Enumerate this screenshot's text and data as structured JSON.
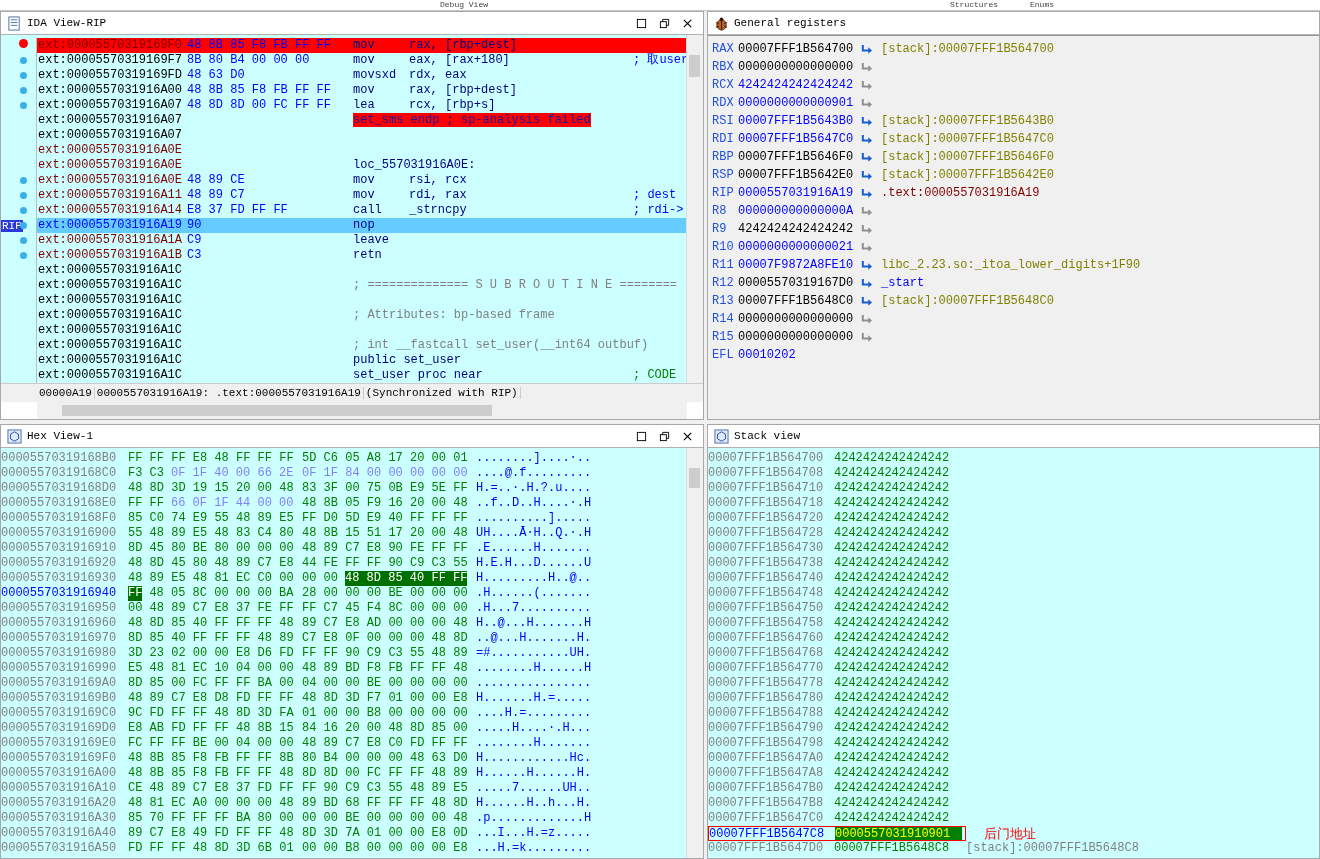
{
  "tabs": [
    {
      "label": "Debug View"
    },
    {
      "label": "Structures"
    },
    {
      "label": "Enums"
    }
  ],
  "ida_view": {
    "title": "IDA View-RIP",
    "rip_label": "RIP",
    "rows": [
      {
        "addr": "ext:00005570319169F0",
        "visited": true,
        "kind": "insn",
        "bytes": "48 8B 85 F8 FB FF FF",
        "mnem": "mov",
        "ops": "rax, [rbp+dest]",
        "breakpoint": true,
        "current": false,
        "traced": false
      },
      {
        "addr": "ext:00005570319169F7",
        "visited": false,
        "kind": "insn",
        "bytes": "8B 80 B4 00 00 00",
        "mnem": "mov",
        "ops": "eax, [rax+180]",
        "comment": "; 取user",
        "breakpoint": false,
        "current": false,
        "traced": true
      },
      {
        "addr": "ext:00005570319169FD",
        "visited": false,
        "kind": "insn",
        "bytes": "48 63 D0",
        "mnem": "movsxd",
        "ops": "rdx, eax",
        "breakpoint": false,
        "current": false,
        "traced": true
      },
      {
        "addr": "ext:0000557031916A00",
        "visited": false,
        "kind": "insn",
        "bytes": "48 8B 85 F8 FB FF FF",
        "mnem": "mov",
        "ops": "rax, [rbp+dest]",
        "breakpoint": false,
        "current": false,
        "traced": true
      },
      {
        "addr": "ext:0000557031916A07",
        "visited": false,
        "kind": "insn",
        "bytes": "48 8D 8D 00 FC FF FF",
        "mnem": "lea",
        "ops": "rcx, [rbp+s]",
        "breakpoint": false,
        "current": false,
        "traced": true
      },
      {
        "addr": "ext:0000557031916A07",
        "visited": false,
        "kind": "error",
        "text": "set_sms endp ; sp-analysis failed",
        "breakpoint": false,
        "current": false,
        "traced": false
      },
      {
        "addr": "ext:0000557031916A07",
        "visited": false,
        "kind": "blank",
        "breakpoint": false,
        "current": false,
        "traced": false
      },
      {
        "addr": "ext:0000557031916A0E",
        "visited": true,
        "kind": "blank",
        "breakpoint": false,
        "current": false,
        "traced": false
      },
      {
        "addr": "ext:0000557031916A0E",
        "visited": true,
        "kind": "label",
        "text": "loc_557031916A0E:",
        "breakpoint": false,
        "current": false,
        "traced": false
      },
      {
        "addr": "ext:0000557031916A0E",
        "visited": true,
        "kind": "insn",
        "bytes": "48 89 CE",
        "mnem": "mov",
        "ops": "rsi, rcx",
        "breakpoint": false,
        "current": false,
        "traced": true
      },
      {
        "addr": "ext:0000557031916A11",
        "visited": true,
        "kind": "insn",
        "bytes": "48 89 C7",
        "mnem": "mov",
        "ops": "rdi, rax",
        "comment": "; dest",
        "breakpoint": false,
        "current": false,
        "traced": true
      },
      {
        "addr": "ext:0000557031916A14",
        "visited": true,
        "kind": "insn",
        "bytes": "E8 37 FD FF FF",
        "mnem": "call",
        "ops": "_strncpy",
        "comment": "; rdi->",
        "breakpoint": false,
        "current": false,
        "traced": true
      },
      {
        "addr": "ext:0000557031916A19",
        "kind": "insn",
        "bytes": "90",
        "mnem": "nop",
        "breakpoint": false,
        "current": true,
        "traced": true
      },
      {
        "addr": "ext:0000557031916A1A",
        "visited": true,
        "kind": "insn",
        "bytes": "C9",
        "mnem": "leave",
        "breakpoint": false,
        "current": false,
        "traced": true
      },
      {
        "addr": "ext:0000557031916A1B",
        "visited": true,
        "kind": "insn",
        "bytes": "C3",
        "mnem": "retn",
        "breakpoint": false,
        "current": false,
        "traced": true
      },
      {
        "addr": "ext:0000557031916A1C",
        "visited": false,
        "kind": "blank",
        "breakpoint": false,
        "current": false,
        "traced": false
      },
      {
        "addr": "ext:0000557031916A1C",
        "visited": false,
        "kind": "comment",
        "text": "; ============== S U B R O U T I N E ========",
        "breakpoint": false,
        "current": false,
        "traced": false
      },
      {
        "addr": "ext:0000557031916A1C",
        "visited": false,
        "kind": "blank",
        "breakpoint": false,
        "current": false,
        "traced": false
      },
      {
        "addr": "ext:0000557031916A1C",
        "visited": false,
        "kind": "comment",
        "text": "; Attributes: bp-based frame",
        "breakpoint": false,
        "current": false,
        "traced": false
      },
      {
        "addr": "ext:0000557031916A1C",
        "visited": false,
        "kind": "blank",
        "breakpoint": false,
        "current": false,
        "traced": false
      },
      {
        "addr": "ext:0000557031916A1C",
        "visited": false,
        "kind": "comment",
        "text": "; int __fastcall set_user(__int64 outbuf)",
        "breakpoint": false,
        "current": false,
        "traced": false
      },
      {
        "addr": "ext:0000557031916A1C",
        "visited": false,
        "kind": "directive",
        "text": "public set_user",
        "breakpoint": false,
        "current": false,
        "traced": false
      },
      {
        "addr": "ext:0000557031916A1C",
        "visited": false,
        "kind": "directive",
        "text": "set_user proc near",
        "comment": "; CODE",
        "xref": true,
        "breakpoint": false,
        "current": false,
        "traced": false
      }
    ],
    "status": [
      "00000A19",
      "0000557031916A19: .text:0000557031916A19",
      "(Synchronized with RIP)"
    ]
  },
  "registers": {
    "title": "General registers",
    "rows": [
      {
        "name": "RAX",
        "value": "00007FFF1B564700",
        "changed": false,
        "target": {
          "text": "[stack]:00007FFF1B564700",
          "kind": "stack"
        }
      },
      {
        "name": "RBX",
        "value": "0000000000000000",
        "changed": false
      },
      {
        "name": "RCX",
        "value": "4242424242424242",
        "changed": true
      },
      {
        "name": "RDX",
        "value": "0000000000000901",
        "changed": true
      },
      {
        "name": "RSI",
        "value": "00007FFF1B5643B0",
        "changed": true,
        "target": {
          "text": "[stack]:00007FFF1B5643B0",
          "kind": "stack"
        }
      },
      {
        "name": "RDI",
        "value": "00007FFF1B5647C0",
        "changed": true,
        "target": {
          "text": "[stack]:00007FFF1B5647C0",
          "kind": "stack"
        }
      },
      {
        "name": "RBP",
        "value": "00007FFF1B5646F0",
        "changed": false,
        "target": {
          "text": "[stack]:00007FFF1B5646F0",
          "kind": "stack"
        }
      },
      {
        "name": "RSP",
        "value": "00007FFF1B5642E0",
        "changed": false,
        "target": {
          "text": "[stack]:00007FFF1B5642E0",
          "kind": "stack"
        }
      },
      {
        "name": "RIP",
        "value": "0000557031916A19",
        "changed": true,
        "target": {
          "text": ".text:0000557031916A19",
          "kind": "code"
        }
      },
      {
        "name": "R8",
        "value": "000000000000000A",
        "changed": true
      },
      {
        "name": "R9",
        "value": "4242424242424242",
        "changed": false
      },
      {
        "name": "R10",
        "value": "0000000000000021",
        "changed": true
      },
      {
        "name": "R11",
        "value": "00007F9872A8FE10",
        "changed": true,
        "target": {
          "text": "libc_2.23.so:_itoa_lower_digits+1F90",
          "kind": "lib"
        }
      },
      {
        "name": "R12",
        "value": "00005570319167D0",
        "changed": false,
        "target": {
          "text": "_start",
          "kind": "symbol"
        }
      },
      {
        "name": "R13",
        "value": "00007FFF1B5648C0",
        "changed": false,
        "target": {
          "text": "[stack]:00007FFF1B5648C0",
          "kind": "stack"
        }
      },
      {
        "name": "R14",
        "value": "0000000000000000",
        "changed": false
      },
      {
        "name": "R15",
        "value": "0000000000000000",
        "changed": false
      },
      {
        "name": "EFL",
        "value": "00010202",
        "changed": true,
        "kind": "flags"
      }
    ]
  },
  "hex_view": {
    "title": "Hex View-1",
    "rows": [
      {
        "addr": "00005570319168B0",
        "current": false,
        "left": [
          {
            "bytes": "FF FF FF E8 48 FF FF FF",
            "kind": "code"
          }
        ],
        "right": [
          {
            "bytes": "5D C6 05 A8 17 20 00 01",
            "kind": "code"
          }
        ],
        "ascii": "........]....·.."
      },
      {
        "addr": "00005570319168C0",
        "current": false,
        "left": [
          {
            "bytes": "F3 C3",
            "kind": "code"
          },
          {
            "bytes": "0F 1F 40 00 66 2E",
            "kind": "align"
          }
        ],
        "right": [
          {
            "bytes": "0F 1F 84 00 00 00 00 00",
            "kind": "align"
          }
        ],
        "ascii": "....@.f........."
      },
      {
        "addr": "00005570319168D0",
        "current": false,
        "left": [
          {
            "bytes": "48 8D 3D 19 15 20 00 48",
            "kind": "code"
          }
        ],
        "right": [
          {
            "bytes": "83 3F 00 75 0B E9 5E FF",
            "kind": "code"
          }
        ],
        "ascii": "H.=..·.H.?.u...."
      },
      {
        "addr": "00005570319168E0",
        "current": false,
        "left": [
          {
            "bytes": "FF FF",
            "kind": "code"
          },
          {
            "bytes": "66 0F 1F 44 00 00",
            "kind": "align"
          }
        ],
        "right": [
          {
            "bytes": "48 8B 05 F9 16 20 00 48",
            "kind": "code"
          }
        ],
        "ascii": "..f..D..H....·.H"
      },
      {
        "addr": "00005570319168F0",
        "current": false,
        "left": [
          {
            "bytes": "85 C0 74 E9 55 48 89 E5",
            "kind": "code"
          }
        ],
        "right": [
          {
            "bytes": "FF D0 5D E9 40 FF FF FF",
            "kind": "code"
          }
        ],
        "ascii": "..........]....."
      },
      {
        "addr": "0000557031916900",
        "current": false,
        "left": [
          {
            "bytes": "55 48 89 E5 48 83 C4 80",
            "kind": "code"
          }
        ],
        "right": [
          {
            "bytes": "48 8B 15 51 17 20 00 48",
            "kind": "code"
          }
        ],
        "ascii": "UH....Ā·H..Q.·.H"
      },
      {
        "addr": "0000557031916910",
        "current": false,
        "left": [
          {
            "bytes": "8D 45 80 BE 80 00 00 00",
            "kind": "code"
          }
        ],
        "right": [
          {
            "bytes": "48 89 C7 E8 90 FE FF FF",
            "kind": "code"
          }
        ],
        "ascii": ".E......H......."
      },
      {
        "addr": "0000557031916920",
        "current": false,
        "left": [
          {
            "bytes": "48 8D 45 80 48 89 C7 E8",
            "kind": "code"
          }
        ],
        "right": [
          {
            "bytes": "44 FE FF FF 90 C9 C3 55",
            "kind": "code"
          }
        ],
        "ascii": "H.E.H...D......U"
      },
      {
        "addr": "0000557031916930",
        "current": false,
        "left": [
          {
            "bytes": "48 89 E5 48 81 EC C0 00",
            "kind": "code"
          }
        ],
        "right": [
          {
            "bytes": "00 00",
            "kind": "code"
          },
          {
            "bytes": "48 8D 85 40 FF FF",
            "kind": "selected"
          }
        ],
        "ascii": "H.........H..@.."
      },
      {
        "addr": "0000557031916940",
        "current": true,
        "left": [
          {
            "bytes": "FF",
            "kind": "selected"
          },
          {
            "bytes": "48 05 8C 00 00 00 BA",
            "kind": "code"
          }
        ],
        "right": [
          {
            "bytes": "28 00 00 00 BE 00 00 00",
            "kind": "code"
          }
        ],
        "ascii": ".H......(......."
      },
      {
        "addr": "0000557031916950",
        "current": false,
        "left": [
          {
            "bytes": "00 48 89 C7 E8 37 FE FF",
            "kind": "code"
          }
        ],
        "right": [
          {
            "bytes": "FF C7 45 F4 8C 00 00 00",
            "kind": "code"
          }
        ],
        "ascii": ".H...7.........."
      },
      {
        "addr": "0000557031916960",
        "current": false,
        "left": [
          {
            "bytes": "48 8D 85 40 FF FF FF 48",
            "kind": "code"
          }
        ],
        "right": [
          {
            "bytes": "89 C7 E8 AD 00 00 00 48",
            "kind": "code"
          }
        ],
        "ascii": "H..@...H.......H"
      },
      {
        "addr": "0000557031916970",
        "current": false,
        "left": [
          {
            "bytes": "8D 85 40 FF FF FF 48 89",
            "kind": "code"
          }
        ],
        "right": [
          {
            "bytes": "C7 E8 0F 00 00 00 48 8D",
            "kind": "code"
          }
        ],
        "ascii": "..@...H.......H."
      },
      {
        "addr": "0000557031916980",
        "current": false,
        "left": [
          {
            "bytes": "3D 23 02 00 00 E8 D6 FD",
            "kind": "code"
          }
        ],
        "right": [
          {
            "bytes": "FF FF 90 C9 C3 55 48 89",
            "kind": "code"
          }
        ],
        "ascii": "=#...........UH."
      },
      {
        "addr": "0000557031916990",
        "current": false,
        "left": [
          {
            "bytes": "E5 48 81 EC 10 04 00 00",
            "kind": "code"
          }
        ],
        "right": [
          {
            "bytes": "48 89 BD F8 FB FF FF 48",
            "kind": "code"
          }
        ],
        "ascii": "........H......H"
      },
      {
        "addr": "00005570319169A0",
        "current": false,
        "left": [
          {
            "bytes": "8D 85 00 FC FF FF BA 00",
            "kind": "code"
          }
        ],
        "right": [
          {
            "bytes": "04 00 00 BE 00 00 00 00",
            "kind": "code"
          }
        ],
        "ascii": "................"
      },
      {
        "addr": "00005570319169B0",
        "current": false,
        "left": [
          {
            "bytes": "48 89 C7 E8 D8 FD FF FF",
            "kind": "code"
          }
        ],
        "right": [
          {
            "bytes": "48 8D 3D F7 01 00 00 E8",
            "kind": "code"
          }
        ],
        "ascii": "H.......H.=....."
      },
      {
        "addr": "00005570319169C0",
        "current": false,
        "left": [
          {
            "bytes": "9C FD FF FF 48 8D 3D FA",
            "kind": "code"
          }
        ],
        "right": [
          {
            "bytes": "01 00 00 B8 00 00 00 00",
            "kind": "code"
          }
        ],
        "ascii": "....H.=........."
      },
      {
        "addr": "00005570319169D0",
        "current": false,
        "left": [
          {
            "bytes": "E8 AB FD FF FF 48 8B 15",
            "kind": "code"
          }
        ],
        "right": [
          {
            "bytes": "84 16 20 00 48 8D 85 00",
            "kind": "code"
          }
        ],
        "ascii": ".....H....·.H..."
      },
      {
        "addr": "00005570319169E0",
        "current": false,
        "left": [
          {
            "bytes": "FC FF FF BE 00 04 00 00",
            "kind": "code"
          }
        ],
        "right": [
          {
            "bytes": "48 89 C7 E8 C0 FD FF FF",
            "kind": "code"
          }
        ],
        "ascii": "........H......."
      },
      {
        "addr": "00005570319169F0",
        "current": false,
        "left": [
          {
            "bytes": "48 8B 85 F8 FB FF FF 8B",
            "kind": "code"
          }
        ],
        "right": [
          {
            "bytes": "80 B4 00 00 00 48 63 D0",
            "kind": "code"
          }
        ],
        "ascii": "H............Hc."
      },
      {
        "addr": "0000557031916A00",
        "current": false,
        "left": [
          {
            "bytes": "48 8B 85 F8 FB FF FF 48",
            "kind": "code"
          }
        ],
        "right": [
          {
            "bytes": "8D 8D 00 FC FF FF 48 89",
            "kind": "code"
          }
        ],
        "ascii": "H......H......H."
      },
      {
        "addr": "0000557031916A10",
        "current": false,
        "left": [
          {
            "bytes": "CE 48 89 C7 E8 37 FD FF",
            "kind": "code"
          }
        ],
        "right": [
          {
            "bytes": "FF 90 C9 C3 55 48 89 E5",
            "kind": "code"
          }
        ],
        "ascii": ".....7......UH.."
      },
      {
        "addr": "0000557031916A20",
        "current": false,
        "left": [
          {
            "bytes": "48 81 EC A0 00 00 00 48",
            "kind": "code"
          }
        ],
        "right": [
          {
            "bytes": "89 BD 68 FF FF FF 48 8D",
            "kind": "code"
          }
        ],
        "ascii": "H......H..h...H."
      },
      {
        "addr": "0000557031916A30",
        "current": false,
        "left": [
          {
            "bytes": "85 70 FF FF FF BA 80 00",
            "kind": "code"
          }
        ],
        "right": [
          {
            "bytes": "00 00 BE 00 00 00 00 48",
            "kind": "code"
          }
        ],
        "ascii": ".p.............H"
      },
      {
        "addr": "0000557031916A40",
        "current": false,
        "left": [
          {
            "bytes": "89 C7 E8 49 FD FF FF 48",
            "kind": "code"
          }
        ],
        "right": [
          {
            "bytes": "8D 3D 7A 01 00 00 E8 0D",
            "kind": "code"
          }
        ],
        "ascii": "...I...H.=z....."
      },
      {
        "addr": "0000557031916A50",
        "current": false,
        "left": [
          {
            "bytes": "FD FF FF 48 8D 3D 6B 01",
            "kind": "code"
          }
        ],
        "right": [
          {
            "bytes": "00 00 B8 00 00 00 00 E8",
            "kind": "code"
          }
        ],
        "ascii": "...H.=k........."
      }
    ]
  },
  "stack_view": {
    "title": "Stack view",
    "rows": [
      {
        "addr": "00007FFF1B564700",
        "value": "4242424242424242",
        "selected": false
      },
      {
        "addr": "00007FFF1B564708",
        "value": "4242424242424242",
        "selected": false
      },
      {
        "addr": "00007FFF1B564710",
        "value": "4242424242424242",
        "selected": false
      },
      {
        "addr": "00007FFF1B564718",
        "value": "4242424242424242",
        "selected": false
      },
      {
        "addr": "00007FFF1B564720",
        "value": "4242424242424242",
        "selected": false
      },
      {
        "addr": "00007FFF1B564728",
        "value": "4242424242424242",
        "selected": false
      },
      {
        "addr": "00007FFF1B564730",
        "value": "4242424242424242",
        "selected": false
      },
      {
        "addr": "00007FFF1B564738",
        "value": "4242424242424242",
        "selected": false
      },
      {
        "addr": "00007FFF1B564740",
        "value": "4242424242424242",
        "selected": false
      },
      {
        "addr": "00007FFF1B564748",
        "value": "4242424242424242",
        "selected": false
      },
      {
        "addr": "00007FFF1B564750",
        "value": "4242424242424242",
        "selected": false
      },
      {
        "addr": "00007FFF1B564758",
        "value": "4242424242424242",
        "selected": false
      },
      {
        "addr": "00007FFF1B564760",
        "value": "4242424242424242",
        "selected": false
      },
      {
        "addr": "00007FFF1B564768",
        "value": "4242424242424242",
        "selected": false
      },
      {
        "addr": "00007FFF1B564770",
        "value": "4242424242424242",
        "selected": false
      },
      {
        "addr": "00007FFF1B564778",
        "value": "4242424242424242",
        "selected": false
      },
      {
        "addr": "00007FFF1B564780",
        "value": "4242424242424242",
        "selected": false
      },
      {
        "addr": "00007FFF1B564788",
        "value": "4242424242424242",
        "selected": false
      },
      {
        "addr": "00007FFF1B564790",
        "value": "4242424242424242",
        "selected": false
      },
      {
        "addr": "00007FFF1B564798",
        "value": "4242424242424242",
        "selected": false
      },
      {
        "addr": "00007FFF1B5647A0",
        "value": "4242424242424242",
        "selected": false
      },
      {
        "addr": "00007FFF1B5647A8",
        "value": "4242424242424242",
        "selected": false
      },
      {
        "addr": "00007FFF1B5647B0",
        "value": "4242424242424242",
        "selected": false
      },
      {
        "addr": "00007FFF1B5647B8",
        "value": "4242424242424242",
        "selected": false
      },
      {
        "addr": "00007FFF1B5647C0",
        "value": "4242424242424242",
        "selected": false
      },
      {
        "addr": "00007FFF1B5647C8",
        "value": "0000557031910901",
        "selected": true,
        "annotation": "后门地址"
      },
      {
        "addr": "00007FFF1B5647D0",
        "value": "00007FFF1B5648C8",
        "selected": false,
        "comment": "[stack]:00007FFF1B5648C8"
      }
    ]
  }
}
